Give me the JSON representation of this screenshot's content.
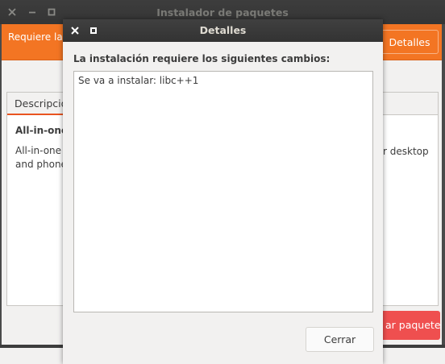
{
  "main_window": {
    "title": "Instalador de paquetes",
    "infobar_text": "Requiere la",
    "details_button": "Detalles",
    "tab_label": "Descripció",
    "package_name": "All-in-one",
    "package_desc_left_line1": "All-in-one v",
    "package_desc_left_line2": "and phone",
    "package_desc_right_line1": "r desktop",
    "install_button": "ar paquete"
  },
  "dialog": {
    "title": "Detalles",
    "heading": "La instalación requiere los siguientes cambios:",
    "changes_text": "Se va a instalar: libc++1",
    "close_button": "Cerrar"
  },
  "colors": {
    "infobar": "#f37523",
    "install_button": "#ef4f4f",
    "titlebar": "#3d3d3d",
    "tab_underline": "#e95420"
  }
}
